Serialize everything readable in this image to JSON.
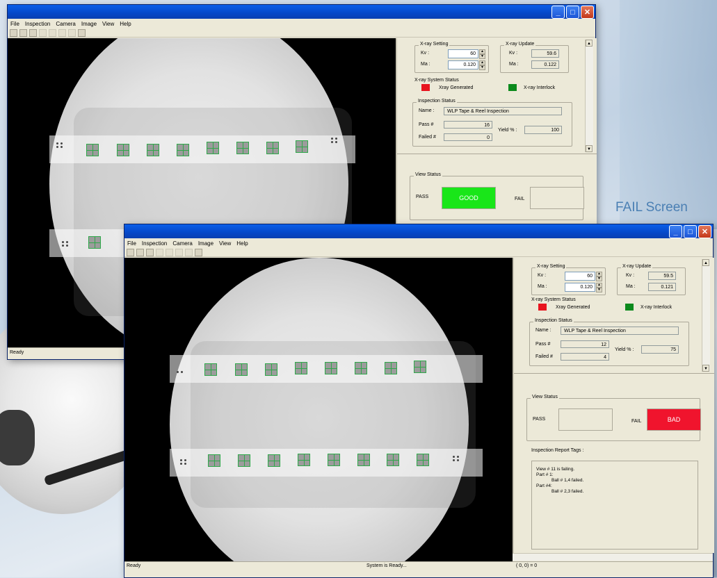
{
  "caption": "FAIL Screen",
  "menu": [
    "File",
    "Inspection",
    "Camera",
    "Image",
    "View",
    "Help"
  ],
  "window_buttons": {
    "minimize": "_",
    "maximize": "□",
    "close": "✕"
  },
  "top": {
    "xray_setting": {
      "title": "X-ray Setting",
      "kv_label": "Kv :",
      "kv_value": "60",
      "ma_label": "Ma :",
      "ma_value": "0.120"
    },
    "xray_update": {
      "title": "X-ray Update",
      "kv_label": "Kv :",
      "kv_value": "59.6",
      "ma_label": "Ma :",
      "ma_value": "0.122"
    },
    "system_status": {
      "title": "X-ray System Status",
      "generated_label": "Xray Generated",
      "interlock_label": "X-ray Interlock"
    },
    "inspection": {
      "title": "Inspection Status",
      "name_label": "Name :",
      "name_value": "WLP Tape & Reel Inspection",
      "pass_label": "Pass #",
      "pass_value": "16",
      "failed_label": "Failed #",
      "failed_value": "0",
      "yield_label": "Yield % :",
      "yield_value": "100"
    },
    "view_status": {
      "title": "View Status",
      "pass_label": "PASS",
      "pass_text": "GOOD",
      "fail_label": "FAIL",
      "fail_text": ""
    },
    "status_ready": "Ready"
  },
  "bottom": {
    "xray_setting": {
      "title": "X-ray Setting",
      "kv_label": "Kv :",
      "kv_value": "60",
      "ma_label": "Ma :",
      "ma_value": "0.120"
    },
    "xray_update": {
      "title": "X-ray Update",
      "kv_label": "Kv :",
      "kv_value": "59.5",
      "ma_label": "Ma :",
      "ma_value": "0.121"
    },
    "system_status": {
      "title": "X-ray System Status",
      "generated_label": "Xray Generated",
      "interlock_label": "X-ray Interlock"
    },
    "inspection": {
      "title": "Inspection Status",
      "name_label": "Name :",
      "name_value": "WLP Tape & Reel Inspection",
      "pass_label": "Pass #",
      "pass_value": "12",
      "failed_label": "Failed #",
      "failed_value": "4",
      "yield_label": "Yield % :",
      "yield_value": "75"
    },
    "view_status": {
      "title": "View Status",
      "pass_label": "PASS",
      "pass_text": "",
      "fail_label": "FAIL",
      "fail_text": "BAD"
    },
    "report": {
      "title": "Inspection Report Tags :",
      "lines": [
        "View # 11 is failing.",
        "Part # 1:",
        "Ball # 1,4 failed.",
        "Part #4:",
        "Ball # 2,3 failed."
      ]
    },
    "statusbar": {
      "ready": "Ready",
      "message": "System is Ready...",
      "coords": "(    0,      0) =      0"
    }
  },
  "colors": {
    "good": "#19e619",
    "bad": "#f0142d",
    "led_red": "#e8141e",
    "led_green": "#0b8a1c"
  }
}
